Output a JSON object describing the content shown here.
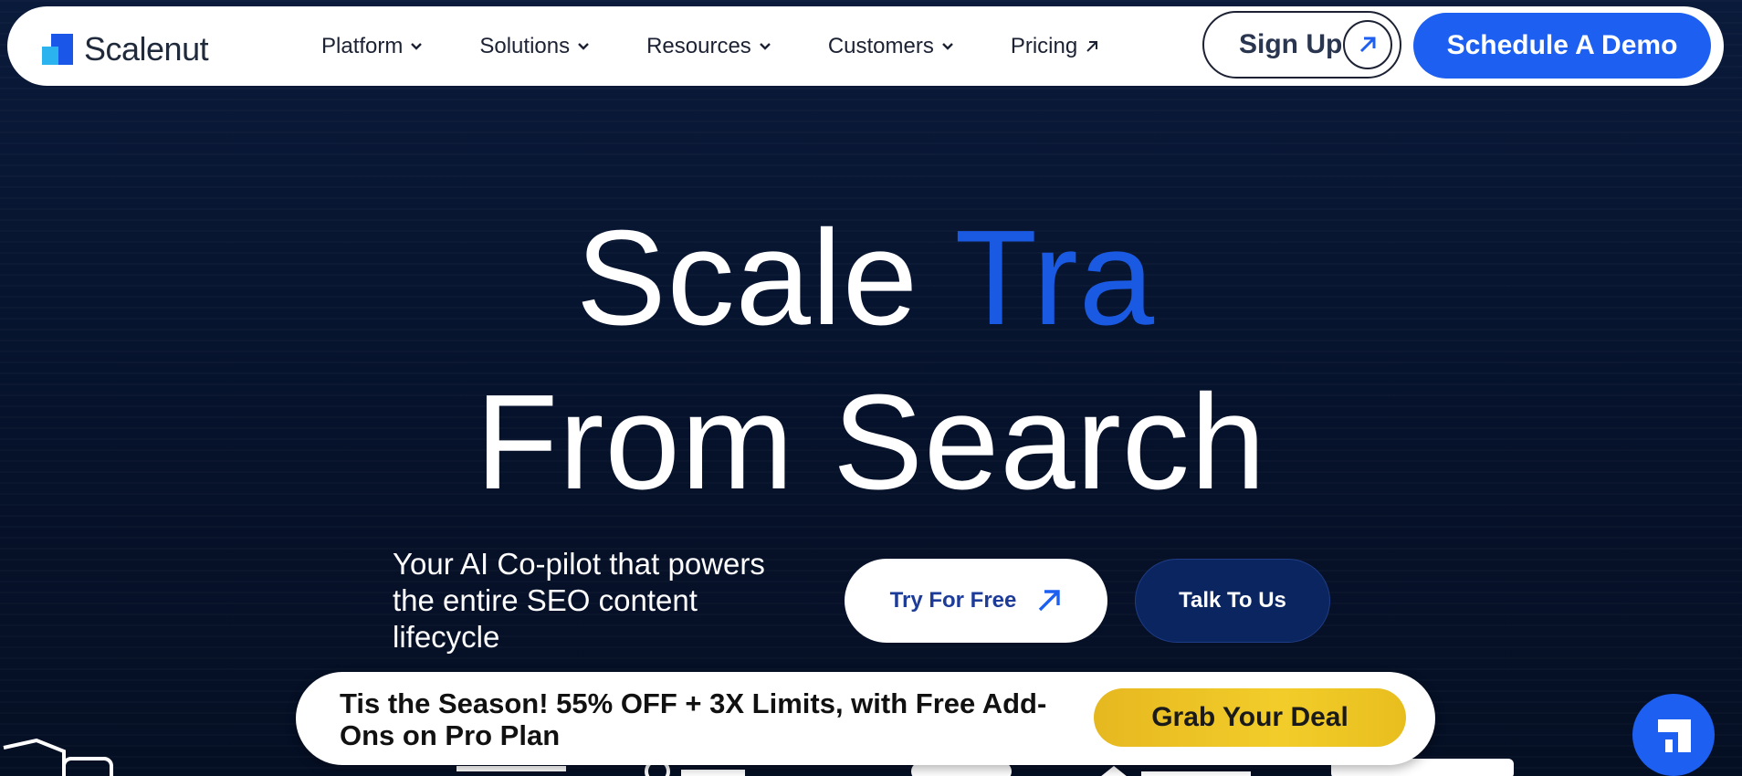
{
  "brand": {
    "name": "Scalenut",
    "colors": {
      "primary": "#1d5ff0",
      "accent": "#2bb3f0",
      "dark": "#06122b",
      "deal": "#f2cd2a"
    }
  },
  "nav": {
    "menu": [
      {
        "label": "Platform",
        "icon": "chevron-down-icon"
      },
      {
        "label": "Solutions",
        "icon": "chevron-down-icon"
      },
      {
        "label": "Resources",
        "icon": "chevron-down-icon"
      },
      {
        "label": "Customers",
        "icon": "chevron-down-icon"
      },
      {
        "label": "Pricing",
        "icon": "arrow-up-right-icon"
      }
    ],
    "signup_label": "Sign Up",
    "demo_label": "Schedule A Demo"
  },
  "hero": {
    "line1_prefix": "Scale",
    "line1_accent": "Tra",
    "line2": "From Search",
    "subtext": "Your AI Co-pilot that powers the entire SEO content lifecycle",
    "try_label": "Try For Free",
    "talk_label": "Talk To Us"
  },
  "promo": {
    "text": "Tis the Season!  55% OFF + 3X Limits, with  Free Add-Ons on Pro Plan",
    "deal_label": "Grab Your Deal"
  },
  "chat": {
    "icon": "scalenut-chat-icon"
  }
}
